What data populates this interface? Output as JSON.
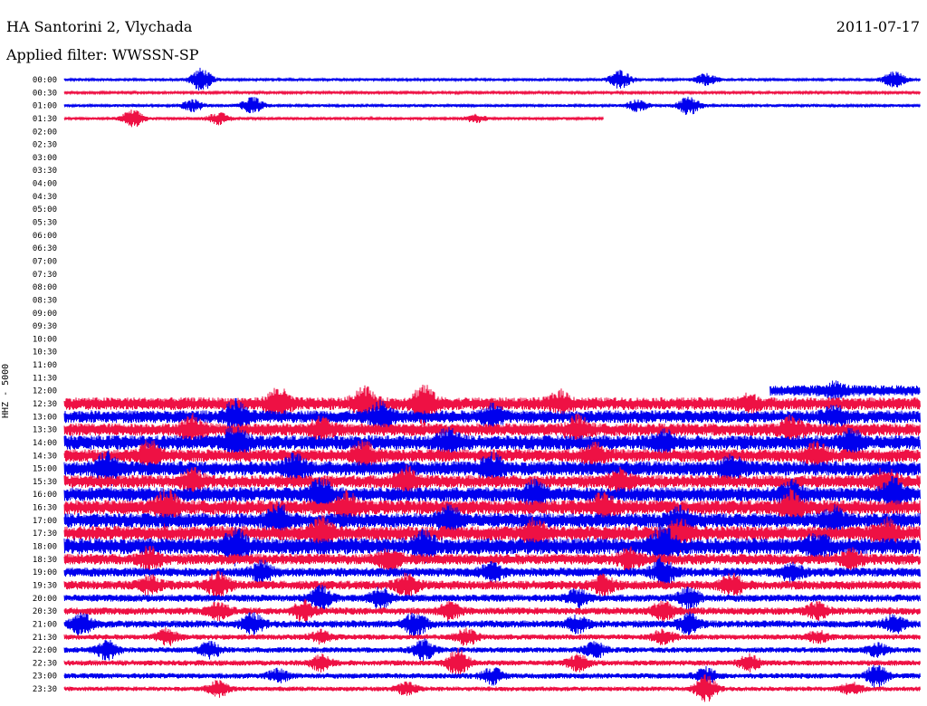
{
  "header": {
    "station": "HA Santorini 2, Vlychada",
    "date": "2011-07-17",
    "filter_label": "Applied filter: WWSSN-SP"
  },
  "chart_data": {
    "type": "helicorder",
    "ylabel": "HHZ - 5000",
    "row_times": [
      "00:00",
      "00:30",
      "01:00",
      "01:30",
      "02:00",
      "02:30",
      "03:00",
      "03:30",
      "04:00",
      "04:30",
      "05:00",
      "05:30",
      "06:00",
      "06:30",
      "07:00",
      "07:30",
      "08:00",
      "08:30",
      "09:00",
      "09:30",
      "10:00",
      "10:30",
      "11:00",
      "11:30",
      "12:00",
      "12:30",
      "13:00",
      "13:30",
      "14:00",
      "14:30",
      "15:00",
      "15:30",
      "16:00",
      "16:30",
      "17:00",
      "17:30",
      "18:00",
      "18:30",
      "19:00",
      "19:30",
      "20:00",
      "20:30",
      "21:00",
      "21:30",
      "22:00",
      "22:30",
      "23:00",
      "23:30"
    ],
    "series_colors": [
      "#0000ee",
      "#ee1144"
    ],
    "rows": [
      {
        "t": "00:00",
        "start": 0,
        "end": 1,
        "amp": 1.5,
        "events": [
          [
            0.16,
            12
          ],
          [
            0.65,
            10
          ],
          [
            0.75,
            6
          ],
          [
            0.97,
            9
          ]
        ]
      },
      {
        "t": "00:30",
        "start": 0,
        "end": 1,
        "amp": 1.2,
        "events": []
      },
      {
        "t": "01:00",
        "start": 0,
        "end": 1,
        "amp": 1.5,
        "events": [
          [
            0.15,
            6
          ],
          [
            0.22,
            9
          ],
          [
            0.67,
            6
          ],
          [
            0.73,
            10
          ]
        ]
      },
      {
        "t": "01:30",
        "start": 0,
        "end": 0.63,
        "amp": 1.5,
        "events": [
          [
            0.08,
            9
          ],
          [
            0.18,
            6
          ],
          [
            0.48,
            4
          ]
        ]
      },
      {
        "t": "12:00",
        "start": 0.825,
        "end": 1,
        "amp": 6,
        "events": [
          [
            0.9,
            6
          ]
        ]
      },
      {
        "t": "12:30",
        "start": 0,
        "end": 1,
        "amp": 7,
        "events": [
          [
            0.25,
            14
          ],
          [
            0.35,
            16
          ],
          [
            0.42,
            18
          ],
          [
            0.58,
            10
          ],
          [
            0.8,
            6
          ]
        ]
      },
      {
        "t": "13:00",
        "start": 0,
        "end": 1,
        "amp": 7,
        "events": [
          [
            0.2,
            14
          ],
          [
            0.37,
            12
          ],
          [
            0.5,
            10
          ],
          [
            0.9,
            8
          ]
        ]
      },
      {
        "t": "13:30",
        "start": 0,
        "end": 1,
        "amp": 7,
        "events": [
          [
            0.15,
            12
          ],
          [
            0.3,
            10
          ],
          [
            0.6,
            12
          ],
          [
            0.85,
            10
          ]
        ]
      },
      {
        "t": "14:00",
        "start": 0,
        "end": 1,
        "amp": 8,
        "events": [
          [
            0.2,
            16
          ],
          [
            0.45,
            12
          ],
          [
            0.7,
            10
          ],
          [
            0.92,
            10
          ]
        ]
      },
      {
        "t": "14:30",
        "start": 0,
        "end": 1,
        "amp": 7,
        "events": [
          [
            0.1,
            12
          ],
          [
            0.35,
            12
          ],
          [
            0.62,
            10
          ],
          [
            0.88,
            12
          ]
        ]
      },
      {
        "t": "15:00",
        "start": 0,
        "end": 1,
        "amp": 8,
        "events": [
          [
            0.05,
            14
          ],
          [
            0.27,
            12
          ],
          [
            0.5,
            12
          ],
          [
            0.78,
            10
          ]
        ]
      },
      {
        "t": "15:30",
        "start": 0,
        "end": 1,
        "amp": 7,
        "events": [
          [
            0.15,
            10
          ],
          [
            0.4,
            12
          ],
          [
            0.65,
            10
          ],
          [
            0.96,
            12
          ]
        ]
      },
      {
        "t": "16:00",
        "start": 0,
        "end": 1,
        "amp": 8,
        "events": [
          [
            0.3,
            14
          ],
          [
            0.55,
            10
          ],
          [
            0.85,
            10
          ],
          [
            0.97,
            14
          ]
        ]
      },
      {
        "t": "16:30",
        "start": 0,
        "end": 1,
        "amp": 8,
        "events": [
          [
            0.12,
            16
          ],
          [
            0.33,
            12
          ],
          [
            0.63,
            12
          ],
          [
            0.85,
            14
          ]
        ]
      },
      {
        "t": "17:00",
        "start": 0,
        "end": 1,
        "amp": 8,
        "events": [
          [
            0.25,
            14
          ],
          [
            0.45,
            12
          ],
          [
            0.72,
            12
          ],
          [
            0.9,
            10
          ]
        ]
      },
      {
        "t": "17:30",
        "start": 0,
        "end": 1,
        "amp": 8,
        "events": [
          [
            0.3,
            14
          ],
          [
            0.55,
            12
          ],
          [
            0.72,
            14
          ],
          [
            0.96,
            12
          ]
        ]
      },
      {
        "t": "18:00",
        "start": 0,
        "end": 1,
        "amp": 9,
        "events": [
          [
            0.2,
            14
          ],
          [
            0.42,
            12
          ],
          [
            0.7,
            18
          ],
          [
            0.88,
            10
          ]
        ]
      },
      {
        "t": "18:30",
        "start": 0,
        "end": 1,
        "amp": 6,
        "events": [
          [
            0.1,
            10
          ],
          [
            0.38,
            10
          ],
          [
            0.66,
            10
          ],
          [
            0.92,
            8
          ]
        ]
      },
      {
        "t": "19:00",
        "start": 0,
        "end": 1,
        "amp": 5,
        "events": [
          [
            0.23,
            10
          ],
          [
            0.5,
            8
          ],
          [
            0.7,
            14
          ],
          [
            0.85,
            8
          ]
        ]
      },
      {
        "t": "19:30",
        "start": 0,
        "end": 1,
        "amp": 5,
        "events": [
          [
            0.1,
            8
          ],
          [
            0.18,
            12
          ],
          [
            0.4,
            10
          ],
          [
            0.63,
            8
          ],
          [
            0.78,
            10
          ]
        ]
      },
      {
        "t": "20:00",
        "start": 0,
        "end": 1,
        "amp": 4,
        "events": [
          [
            0.3,
            12
          ],
          [
            0.37,
            10
          ],
          [
            0.6,
            8
          ],
          [
            0.73,
            10
          ]
        ]
      },
      {
        "t": "20:30",
        "start": 0,
        "end": 1,
        "amp": 4,
        "events": [
          [
            0.18,
            8
          ],
          [
            0.28,
            10
          ],
          [
            0.45,
            8
          ],
          [
            0.7,
            10
          ],
          [
            0.88,
            8
          ]
        ]
      },
      {
        "t": "21:00",
        "start": 0,
        "end": 1,
        "amp": 4,
        "events": [
          [
            0.02,
            10
          ],
          [
            0.22,
            10
          ],
          [
            0.41,
            12
          ],
          [
            0.6,
            8
          ],
          [
            0.73,
            10
          ],
          [
            0.97,
            8
          ]
        ]
      },
      {
        "t": "21:30",
        "start": 0,
        "end": 1,
        "amp": 3,
        "events": [
          [
            0.12,
            8
          ],
          [
            0.3,
            6
          ],
          [
            0.47,
            8
          ],
          [
            0.7,
            8
          ],
          [
            0.88,
            6
          ]
        ]
      },
      {
        "t": "22:00",
        "start": 0,
        "end": 1,
        "amp": 3,
        "events": [
          [
            0.05,
            10
          ],
          [
            0.17,
            8
          ],
          [
            0.42,
            10
          ],
          [
            0.62,
            8
          ],
          [
            0.95,
            6
          ]
        ]
      },
      {
        "t": "22:30",
        "start": 0,
        "end": 1,
        "amp": 3,
        "events": [
          [
            0.3,
            8
          ],
          [
            0.46,
            14
          ],
          [
            0.6,
            8
          ],
          [
            0.8,
            8
          ]
        ]
      },
      {
        "t": "23:00",
        "start": 0,
        "end": 1,
        "amp": 3,
        "events": [
          [
            0.25,
            6
          ],
          [
            0.5,
            8
          ],
          [
            0.75,
            8
          ],
          [
            0.95,
            12
          ]
        ]
      },
      {
        "t": "23:30",
        "start": 0,
        "end": 1,
        "amp": 2.5,
        "events": [
          [
            0.18,
            8
          ],
          [
            0.4,
            6
          ],
          [
            0.75,
            14
          ],
          [
            0.92,
            6
          ]
        ]
      }
    ]
  }
}
